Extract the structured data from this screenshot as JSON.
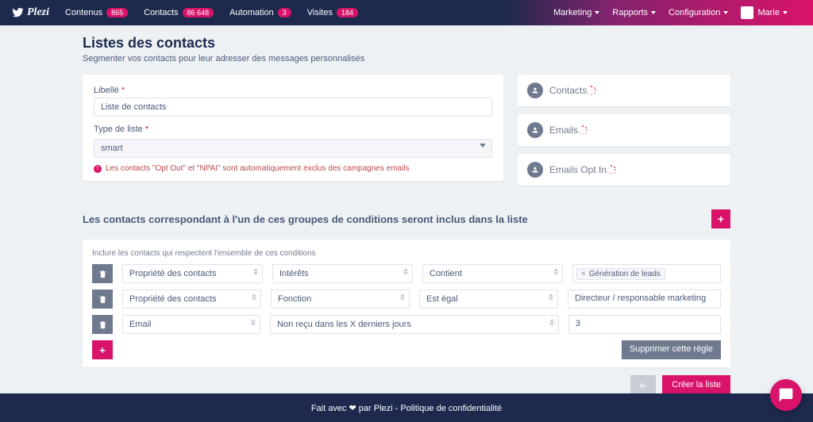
{
  "brand": "Plezi",
  "nav": {
    "items": [
      {
        "label": "Contenus",
        "badge": "865"
      },
      {
        "label": "Contacts",
        "badge": "86 648"
      },
      {
        "label": "Automation",
        "badge": "3"
      },
      {
        "label": "Visites",
        "badge": "184"
      }
    ],
    "right": [
      {
        "label": "Marketing"
      },
      {
        "label": "Rapports"
      },
      {
        "label": "Configuration"
      }
    ],
    "user": "Marie"
  },
  "page": {
    "title": "Listes des contacts",
    "subtitle": "Segmenter vos contacts pour leur adresser des messages personnalisés"
  },
  "form": {
    "libelle_label": "Libellé",
    "libelle_value": "Liste de contacts",
    "type_label": "Type de liste",
    "type_value": "smart",
    "info": "Les contacts \"Opt Out\" et \"NPAI\" sont automatiquement exclus des campagnes emails"
  },
  "stats": [
    {
      "label": "Contacts"
    },
    {
      "label": "Emails"
    },
    {
      "label": "Emails Opt In"
    }
  ],
  "section_title": "Les contacts correspondant à l'un de ces groupes de conditions seront inclus dans la liste",
  "rules": {
    "hint": "Inclure les contacts qui respectent l'ensemble de ces conditions",
    "rows": [
      {
        "source": "Propriété des contacts",
        "field": "Intérêts",
        "op": "Contient",
        "value_tag": "Génération de leads"
      },
      {
        "source": "Propriété des contacts",
        "field": "Fonction",
        "op": "Est égal",
        "value_plain": "Directeur / responsable marketing"
      },
      {
        "source": "Email",
        "field": "Non reçu dans les X derniers jours",
        "value_plain": "3"
      }
    ],
    "delete_rule": "Supprimer cette règle"
  },
  "actions": {
    "create": "Créer la liste"
  },
  "footer": "Fait avec ❤ par Plezi - Politique de confidentialité"
}
